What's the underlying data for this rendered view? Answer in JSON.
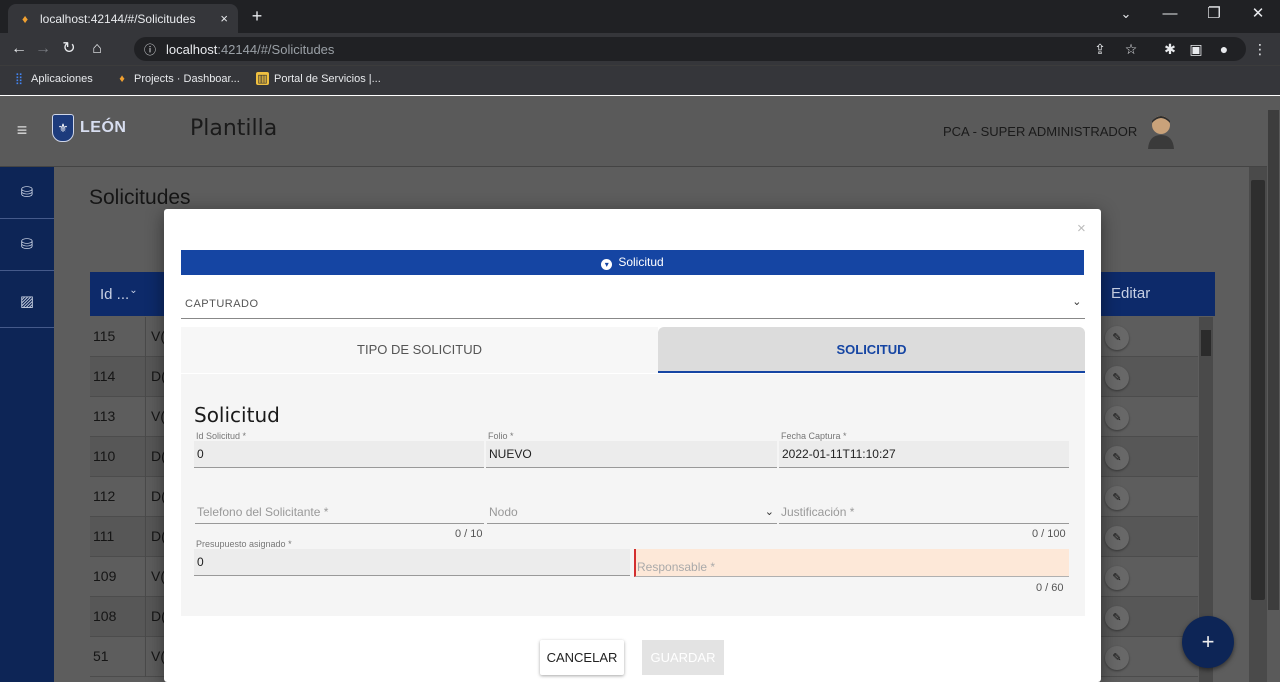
{
  "browser": {
    "tab_title": "localhost:42144/#/Solicitudes",
    "tab_close": "×",
    "new_tab": "+",
    "url_host": "localhost",
    "url_rest": ":42144/#/Solicitudes",
    "window_controls": {
      "minimize": "—",
      "restore": "❐",
      "close": "✕",
      "list": "⌄"
    },
    "bookmarks": [
      {
        "label": "Aplicaciones",
        "icon": "apps-grid-icon"
      },
      {
        "label": "Projects · Dashboar...",
        "icon": "project-icon"
      },
      {
        "label": "Portal de Servicios |...",
        "icon": "portal-icon"
      }
    ]
  },
  "app": {
    "logo_text": "LEÓN",
    "title": "Plantilla",
    "user": "PCA - SUPER ADMINISTRADOR"
  },
  "page": {
    "title": "Solicitudes",
    "table": {
      "col_id": "Id ...",
      "col_edit": "Editar",
      "rows": [
        {
          "id": "115",
          "desc": "V("
        },
        {
          "id": "114",
          "desc": "D("
        },
        {
          "id": "113",
          "desc": "V("
        },
        {
          "id": "110",
          "desc": "D("
        },
        {
          "id": "112",
          "desc": "D("
        },
        {
          "id": "111",
          "desc": "D("
        },
        {
          "id": "109",
          "desc": "V("
        },
        {
          "id": "108",
          "desc": "D("
        },
        {
          "id": "51",
          "desc": "V("
        }
      ]
    },
    "fab": "+"
  },
  "modal": {
    "close": "×",
    "section_bar": "Solicitud",
    "status": "CAPTURADO",
    "tab_tipo": "TIPO DE SOLICITUD",
    "tab_solicitud": "SOLICITUD",
    "form_title": "Solicitud",
    "fields": {
      "id_label": "Id Solicitud *",
      "id_value": "0",
      "folio_label": "Folio *",
      "folio_value": "NUEVO",
      "fecha_label": "Fecha Captura *",
      "fecha_value": "2022-01-11T11:10:27",
      "telefono_placeholder": "Telefono del Solicitante *",
      "telefono_count": "0 / 10",
      "nodo_placeholder": "Nodo",
      "justificacion_placeholder": "Justificación *",
      "justificacion_count": "0 / 100",
      "presupuesto_label": "Presupuesto asignado *",
      "presupuesto_value": "0",
      "responsable_placeholder": "Responsable *",
      "responsable_count": "0 / 60"
    },
    "cancel": "CANCELAR",
    "save": "GUARDAR"
  }
}
